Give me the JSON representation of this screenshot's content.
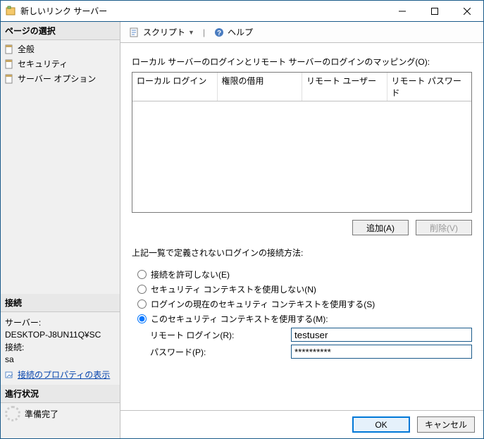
{
  "window": {
    "title": "新しいリンク サーバー"
  },
  "sidebar": {
    "page_select_title": "ページの選択",
    "items": [
      {
        "label": "全般"
      },
      {
        "label": "セキュリティ"
      },
      {
        "label": "サーバー オプション"
      }
    ],
    "connection_title": "接続",
    "server_label": "サーバー:",
    "server_value": "DESKTOP-J8UN11Q¥SC",
    "conn_label": "接続:",
    "conn_value": "sa",
    "conn_props_link": "接続のプロパティの表示",
    "progress_title": "進行状況",
    "progress_status": "準備完了"
  },
  "toolbar": {
    "script_label": "スクリプト",
    "help_label": "ヘルプ"
  },
  "main": {
    "mapping_label": "ローカル サーバーのログインとリモート サーバーのログインのマッピング(O):",
    "grid_headers": {
      "c0": "ローカル ログイン",
      "c1": "権限の借用",
      "c2": "リモート ユーザー",
      "c3": "リモート パスワード"
    },
    "add_button": "追加(A)",
    "delete_button": "削除(V)",
    "undef_login_label": "上記一覧で定義されないログインの接続方法:",
    "radios": {
      "r0": "接続を許可しない(E)",
      "r1": "セキュリティ コンテキストを使用しない(N)",
      "r2": "ログインの現在のセキュリティ コンテキストを使用する(S)",
      "r3": "このセキュリティ コンテキストを使用する(M):"
    },
    "remote_login_label": "リモート ログイン(R):",
    "remote_login_value": "testuser",
    "password_label": "パスワード(P):",
    "password_value": "**********"
  },
  "footer": {
    "ok": "OK",
    "cancel": "キャンセル"
  }
}
